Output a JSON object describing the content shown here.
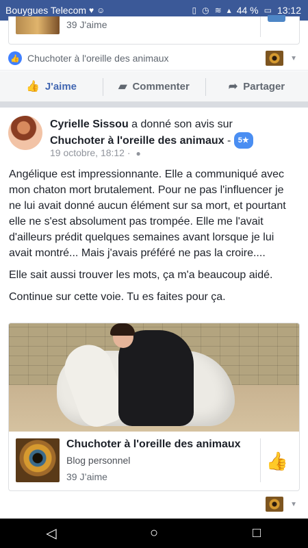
{
  "status_bar": {
    "carrier": "Bouygues Telecom",
    "battery": "44 %",
    "time": "13:12"
  },
  "previous_post": {
    "likes": "39 J'aime",
    "page_row": "Chuchoter à l'oreille des animaux"
  },
  "actions": {
    "like": "J'aime",
    "comment": "Commenter",
    "share": "Partager"
  },
  "post": {
    "author": "Cyrielle Sissou",
    "action_text": "a donné son avis sur",
    "page_name": "Chuchoter à l'oreille des animaux",
    "dash": "-",
    "rating": "5★",
    "date": "19 octobre, 18:12",
    "dot": "·",
    "paragraphs": [
      "Angélique est impressionnante. Elle a communiqué avec mon chaton mort brutalement. Pour ne pas l'influencer je ne lui avait donné aucun élément sur sa mort, et pourtant elle ne s'est absolument pas trompée. Elle me l'avait d'ailleurs prédit quelques semaines avant lorsque je lui avait montré... Mais j'avais préféré ne pas la croire....",
      "Elle sait aussi trouver les mots, ça m'a beaucoup aidé.",
      "Continue sur cette voie. Tu es faites pour ça."
    ],
    "shared_page": {
      "title": "Chuchoter à l'oreille des animaux",
      "category": "Blog personnel",
      "likes": "39 J’aime"
    }
  },
  "icons": {
    "status": [
      "heart-icon",
      "cat-icon",
      "vibrate-icon",
      "alarm-icon",
      "wifi-icon",
      "signal-icon",
      "battery-icon"
    ],
    "actions": [
      "thumbs-up-icon",
      "comment-icon",
      "share-icon"
    ],
    "nav": [
      "back-icon",
      "home-icon",
      "recents-icon"
    ]
  },
  "colors": {
    "status_bar": "#3b5998",
    "accent": "#4267b2",
    "badge": "#4a8ef2"
  }
}
